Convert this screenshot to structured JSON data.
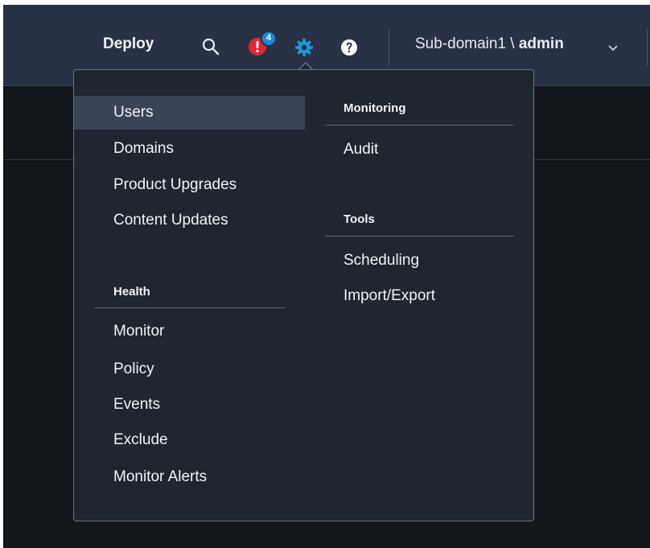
{
  "header": {
    "deploy_label": "Deploy",
    "notification_count": "4",
    "user": {
      "domain_prefix": "Sub-domain1 \\ ",
      "username": "admin"
    }
  },
  "icons": {
    "search": "search-icon",
    "alerts": "alert-bell-icon",
    "settings": "gear-icon",
    "help": "help-icon",
    "dropdown": "chevron-down-icon"
  },
  "colors": {
    "topbar": "#293244",
    "menu_bg": "#1f2630",
    "active_item": "#3a4456",
    "gear_accent": "#1e9bd7",
    "alert_red": "#e0262f",
    "badge_blue": "#1e88d8"
  },
  "menu": {
    "left_items": [
      "Users",
      "Domains",
      "Product Upgrades",
      "Content Updates"
    ],
    "health": {
      "title": "Health",
      "items": [
        "Monitor",
        "Policy",
        "Events",
        "Exclude",
        "Monitor Alerts"
      ]
    },
    "monitoring": {
      "title": "Monitoring",
      "items": [
        "Audit"
      ]
    },
    "tools": {
      "title": "Tools",
      "items": [
        "Scheduling",
        "Import/Export"
      ]
    }
  }
}
